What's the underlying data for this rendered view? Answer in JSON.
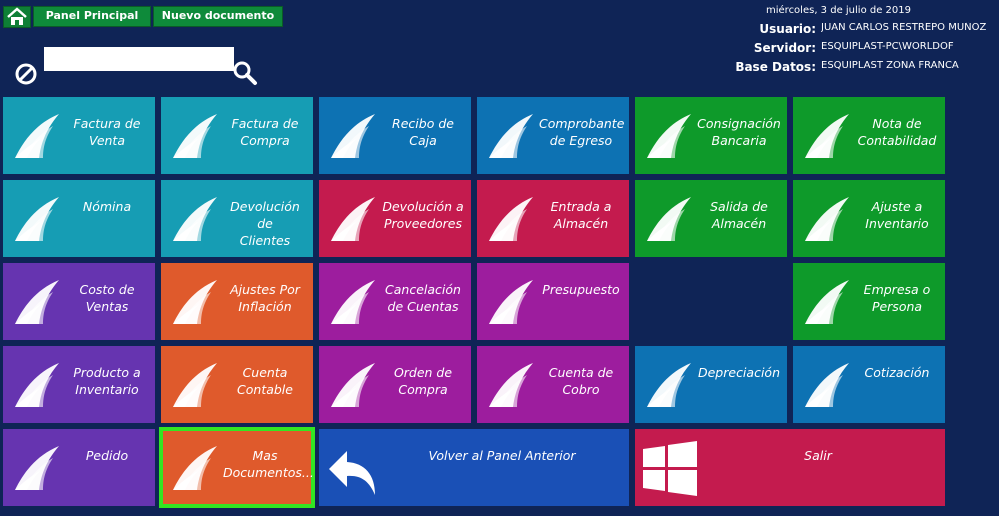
{
  "header": {
    "tabs": [
      {
        "label": "Panel Principal"
      },
      {
        "label": "Nuevo documento"
      }
    ],
    "date": "miércoles, 3 de julio de 2019",
    "usuario_label": "Usuario:",
    "usuario": "JUAN CARLOS RESTREPO MUÑOZ",
    "servidor_label": "Servidor:",
    "servidor": "ESQUIPLAST-PC\\WORLDOF",
    "base_label": "Base Datos:",
    "base": "ESQUIPLAST ZONA FRANCA"
  },
  "search": {
    "value": "",
    "placeholder": ""
  },
  "tiles": [
    {
      "label": "Factura de\nVenta",
      "color": "#169db4"
    },
    {
      "label": "Factura de\nCompra",
      "color": "#169db4"
    },
    {
      "label": "Recibo de\nCaja",
      "color": "#0d72b3"
    },
    {
      "label": "Comprobante\nde Egreso",
      "color": "#0d72b3"
    },
    {
      "label": "Consignación\nBancaria",
      "color": "#0e9a2a"
    },
    {
      "label": "Nota de\nContabilidad",
      "color": "#0e9a2a"
    },
    {
      "label": "Nómina",
      "color": "#169db4"
    },
    {
      "label": "Devolución de\nClientes",
      "color": "#169db4"
    },
    {
      "label": "Devolución a\nProveedores",
      "color": "#c41b4e"
    },
    {
      "label": "Entrada a\nAlmacén",
      "color": "#c41b4e"
    },
    {
      "label": "Salida de\nAlmacén",
      "color": "#0e9a2a"
    },
    {
      "label": "Ajuste a\nInventario",
      "color": "#0e9a2a"
    },
    {
      "label": "Costo de\nVentas",
      "color": "#6634b0"
    },
    {
      "label": "Ajustes Por\nInflación",
      "color": "#df5a2c"
    },
    {
      "label": "Cancelación\nde Cuentas",
      "color": "#9d1d9e"
    },
    {
      "label": "Presupuesto",
      "color": "#9d1d9e"
    },
    {
      "label": "Empresa o\nPersona",
      "color": "#0e9a2a"
    },
    {
      "label": "Producto a\nInventario",
      "color": "#6634b0"
    },
    {
      "label": "Cuenta\nContable",
      "color": "#df5a2c"
    },
    {
      "label": "Orden de\nCompra",
      "color": "#9d1d9e"
    },
    {
      "label": "Cuenta de\nCobro",
      "color": "#9d1d9e"
    },
    {
      "label": "Depreciación",
      "color": "#0d72b3"
    },
    {
      "label": "Cotización",
      "color": "#0d72b3"
    },
    {
      "label": "Pedido",
      "color": "#6634b0"
    },
    {
      "label": "Mas\nDocumentos...",
      "color": "#df5a2c"
    },
    {
      "label": "Volver al Panel Anterior",
      "color": "#1a50b6"
    },
    {
      "label": "Salir",
      "color": "#c41b4e"
    }
  ]
}
